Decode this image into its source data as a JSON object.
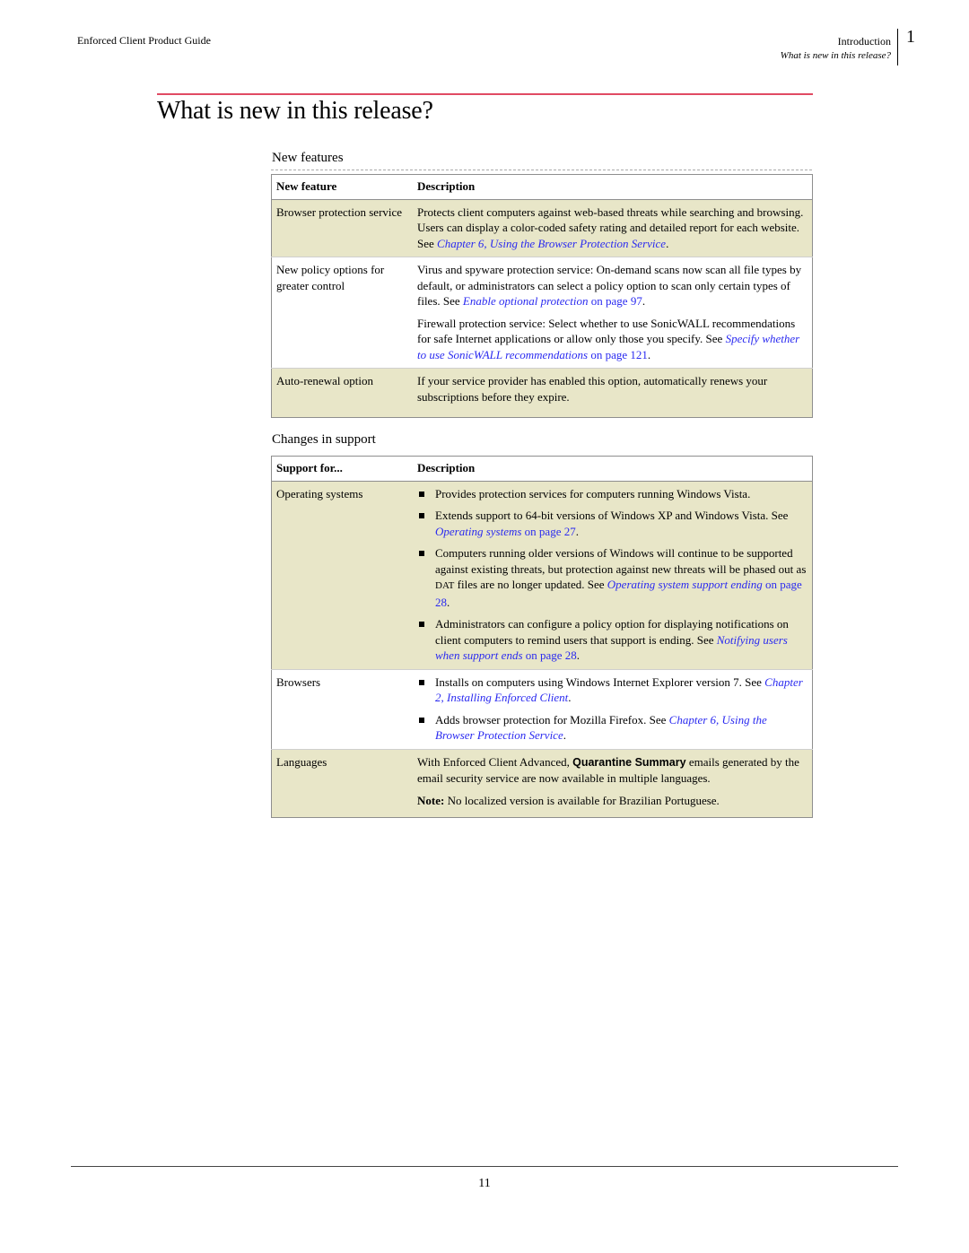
{
  "header": {
    "doc_title": "Enforced Client Product Guide",
    "chapter": "Introduction",
    "section": "What is new in this release?",
    "chapter_number": "1"
  },
  "page_title": "What is new in this release?",
  "new_features": {
    "heading": "New features",
    "columns": [
      "New feature",
      "Description"
    ],
    "rows": [
      {
        "feature": "Browser protection service",
        "paragraphs": [
          {
            "text": "Protects client computers against web-based threats while searching and browsing. Users can display a color-coded safety rating and detailed report for each website. See ",
            "link": "Chapter 6, Using the Browser Protection Service",
            "link_suffix": "",
            "end": "."
          }
        ]
      },
      {
        "feature": "New policy options for greater control",
        "paragraphs": [
          {
            "text": "Virus and spyware protection service: On-demand scans now scan all file types by default, or administrators can select a policy option to scan only certain types of files. See ",
            "link": "Enable optional protection",
            "link_suffix": " on page 97",
            "end": "."
          },
          {
            "text": "Firewall protection service: Select whether to use SonicWALL recommendations for safe Internet applications or allow only those you specify. See ",
            "link": "Specify whether to use SonicWALL recommendations",
            "link_suffix": " on page 121",
            "end": "."
          }
        ]
      },
      {
        "feature": "Auto-renewal option",
        "paragraphs": [
          {
            "text": "If your service provider has enabled this option, automatically renews your subscriptions before they expire.",
            "link": "",
            "link_suffix": "",
            "end": ""
          }
        ]
      }
    ]
  },
  "changes_in_support": {
    "heading": "Changes in support",
    "columns": [
      "Support for...",
      "Description"
    ],
    "operating_systems": {
      "label": "Operating systems",
      "bullets": [
        {
          "text": "Provides protection services for computers running Windows Vista."
        },
        {
          "text": "Extends support to 64-bit versions of Windows XP and Windows Vista. See ",
          "link": "Operating systems",
          "link_suffix": " on page 27",
          "end": "."
        },
        {
          "text_a": "Computers running older versions of Windows will continue to be supported against existing threats, but protection against new threats will be phased out as ",
          "smallcaps": "DAT",
          "text_b": " files are no longer updated. See ",
          "link": "Operating system support ending",
          "link_suffix": " on page 28",
          "end": "."
        },
        {
          "text": "Administrators can configure a policy option for displaying notifications on client computers to remind users that support is ending. See ",
          "link": "Notifying users when support ends",
          "link_suffix": " on page 28",
          "end": "."
        }
      ]
    },
    "browsers": {
      "label": "Browsers",
      "bullets": [
        {
          "text": "Installs on computers using Windows Internet Explorer version 7. See ",
          "link": "Chapter 2, Installing Enforced Client",
          "end": "."
        },
        {
          "text": "Adds browser protection for Mozilla Firefox. See ",
          "link": "Chapter 6, Using the Browser Protection Service",
          "end": "."
        }
      ]
    },
    "languages": {
      "label": "Languages",
      "text_a": "With Enforced Client Advanced, ",
      "bold_term": "Quarantine Summary",
      "text_b": " emails generated by the email security service are now available in multiple languages.",
      "note_label": "Note:",
      "note_text": " No localized version is available for Brazilian Portuguese."
    }
  },
  "footer": {
    "page_number": "11"
  }
}
